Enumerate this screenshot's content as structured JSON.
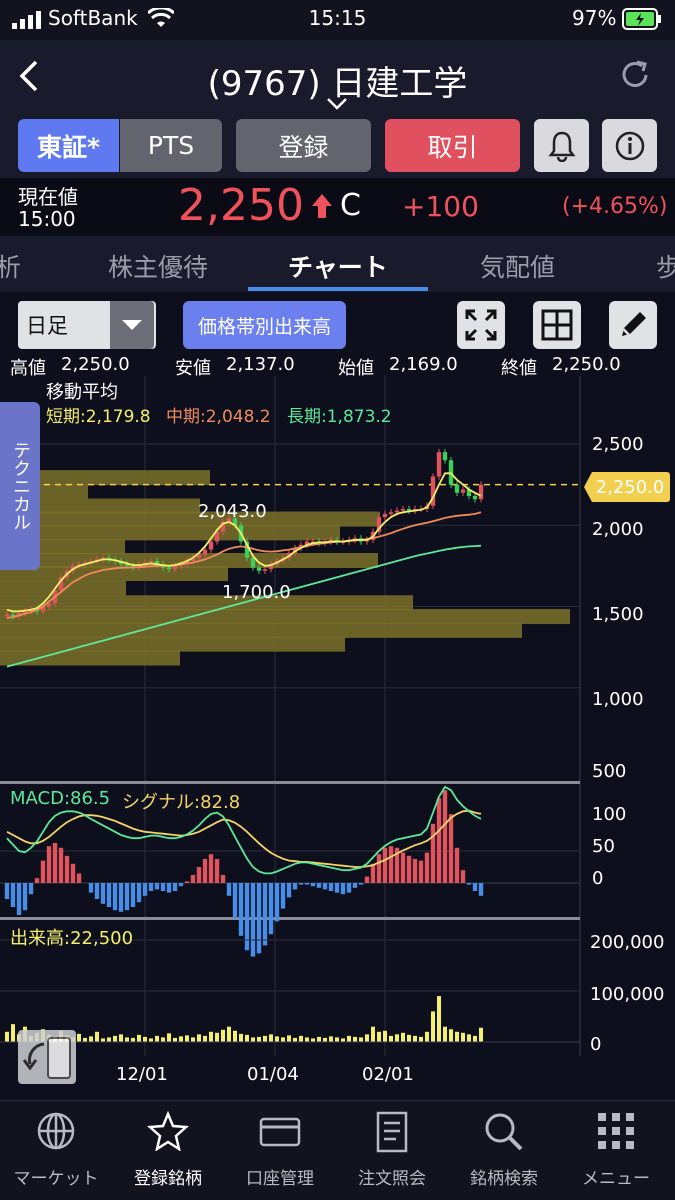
{
  "status": {
    "carrier": "SoftBank",
    "time": "15:15",
    "battery": "97%"
  },
  "header": {
    "title": "(9767) 日建工学"
  },
  "buttons": {
    "market": "東証*",
    "pts": "PTS",
    "register": "登録",
    "trade": "取引"
  },
  "price": {
    "label": "現在値",
    "time": "15:00",
    "value": "2,250",
    "flag": "C",
    "change": "+100",
    "change_pct": "(+4.65%)"
  },
  "tabs": [
    {
      "label": "析"
    },
    {
      "label": "株主優待"
    },
    {
      "label": "チャート"
    },
    {
      "label": "気配値"
    },
    {
      "label": "歩"
    }
  ],
  "chart_controls": {
    "period": "日足",
    "volume_profile": "価格帯別出来高"
  },
  "ohlc": {
    "high_label": "高値",
    "high": "2,250.0",
    "low_label": "安値",
    "low": "2,137.0",
    "open_label": "始値",
    "open": "2,169.0",
    "close_label": "終値",
    "close": "2,250.0"
  },
  "technical_tab": "テクニカル",
  "moving_average": {
    "title": "移動平均",
    "short": "短期:2,179.8",
    "mid": "中期:2,048.2",
    "long": "長期:1,873.2",
    "colors": {
      "short": "#f4f06a",
      "mid": "#f08a5d",
      "long": "#5ee89a"
    }
  },
  "annotations": {
    "peak": "2,043.0",
    "trough": "1,700.0",
    "current": "2,250.0"
  },
  "price_axis": [
    "2,500",
    "2,000",
    "1,500",
    "1,000",
    "500"
  ],
  "macd": {
    "label": "MACD:86.5",
    "signal": "シグナル:82.8",
    "axis": [
      "100",
      "50",
      "0"
    ]
  },
  "volume": {
    "label": "出来高:22,500",
    "axis": [
      "200,000",
      "100,000",
      "0"
    ]
  },
  "x_axis": [
    "12/01",
    "01/04",
    "02/01"
  ],
  "bottom_nav": [
    {
      "label": "マーケット"
    },
    {
      "label": "登録銘柄"
    },
    {
      "label": "口座管理"
    },
    {
      "label": "注文照会"
    },
    {
      "label": "銘柄検索"
    },
    {
      "label": "メニュー"
    }
  ],
  "chart_data": {
    "type": "candlestick",
    "ylim": [
      500,
      2600
    ],
    "closes": [
      1450,
      1440,
      1460,
      1470,
      1480,
      1470,
      1500,
      1520,
      1600,
      1680,
      1720,
      1750,
      1760,
      1770,
      1780,
      1790,
      1800,
      1790,
      1780,
      1760,
      1750,
      1740,
      1760,
      1770,
      1780,
      1760,
      1740,
      1730,
      1750,
      1760,
      1780,
      1800,
      1820,
      1850,
      1900,
      1960,
      2020,
      2043,
      2000,
      1900,
      1800,
      1740,
      1720,
      1730,
      1760,
      1780,
      1800,
      1830,
      1860,
      1880,
      1900,
      1900,
      1890,
      1900,
      1910,
      1900,
      1900,
      1910,
      1920,
      1900,
      1910,
      1960,
      2050,
      2070,
      2080,
      2090,
      2100,
      2090,
      2100,
      2100,
      2120,
      2300,
      2450,
      2400,
      2250,
      2200,
      2220,
      2180,
      2160,
      2250
    ],
    "ma_short": [
      1480,
      1470,
      1470,
      1475,
      1480,
      1490,
      1520,
      1560,
      1610,
      1660,
      1700,
      1730,
      1750,
      1760,
      1770,
      1780,
      1790,
      1790,
      1785,
      1775,
      1765,
      1755,
      1755,
      1760,
      1765,
      1760,
      1755,
      1750,
      1755,
      1765,
      1780,
      1800,
      1830,
      1870,
      1920,
      1970,
      2010,
      2020,
      2000,
      1950,
      1880,
      1810,
      1770,
      1750,
      1755,
      1770,
      1790,
      1810,
      1840,
      1860,
      1880,
      1890,
      1895,
      1895,
      1900,
      1900,
      1900,
      1905,
      1910,
      1910,
      1910,
      1930,
      1980,
      2020,
      2050,
      2070,
      2080,
      2085,
      2090,
      2095,
      2110,
      2170,
      2250,
      2320,
      2320,
      2280,
      2250,
      2220,
      2200,
      2180
    ],
    "ma_mid": [
      1430,
      1435,
      1445,
      1455,
      1465,
      1480,
      1500,
      1530,
      1560,
      1590,
      1620,
      1650,
      1670,
      1690,
      1705,
      1715,
      1725,
      1730,
      1735,
      1738,
      1740,
      1740,
      1742,
      1745,
      1748,
      1750,
      1750,
      1752,
      1755,
      1760,
      1765,
      1770,
      1780,
      1790,
      1805,
      1820,
      1840,
      1855,
      1865,
      1870,
      1865,
      1855,
      1845,
      1840,
      1838,
      1840,
      1845,
      1850,
      1858,
      1865,
      1872,
      1880,
      1886,
      1890,
      1895,
      1898,
      1900,
      1903,
      1906,
      1910,
      1914,
      1920,
      1930,
      1940,
      1952,
      1965,
      1978,
      1990,
      2000,
      2008,
      2015,
      2025,
      2035,
      2045,
      2052,
      2058,
      2062,
      2065,
      2070,
      2080
    ],
    "ma_long": [
      1130,
      1140,
      1150,
      1160,
      1170,
      1180,
      1190,
      1200,
      1210,
      1220,
      1230,
      1240,
      1250,
      1260,
      1270,
      1280,
      1290,
      1300,
      1310,
      1320,
      1330,
      1340,
      1350,
      1360,
      1370,
      1380,
      1390,
      1400,
      1410,
      1420,
      1430,
      1440,
      1450,
      1460,
      1470,
      1480,
      1490,
      1500,
      1510,
      1520,
      1530,
      1540,
      1550,
      1560,
      1570,
      1580,
      1590,
      1600,
      1610,
      1620,
      1630,
      1640,
      1650,
      1660,
      1670,
      1680,
      1690,
      1700,
      1710,
      1720,
      1730,
      1740,
      1750,
      1760,
      1770,
      1780,
      1790,
      1800,
      1810,
      1818,
      1826,
      1834,
      1842,
      1850,
      1856,
      1862,
      1866,
      1870,
      1872,
      1874
    ],
    "macd": [
      70,
      60,
      50,
      48,
      55,
      65,
      80,
      95,
      105,
      110,
      112,
      112,
      110,
      106,
      100,
      95,
      90,
      85,
      80,
      75,
      72,
      70,
      70,
      72,
      74,
      74,
      72,
      70,
      70,
      72,
      76,
      82,
      90,
      100,
      108,
      110,
      104,
      90,
      72,
      55,
      38,
      25,
      18,
      15,
      15,
      18,
      22,
      26,
      30,
      32,
      32,
      30,
      28,
      26,
      24,
      22,
      20,
      20,
      22,
      24,
      30,
      40,
      50,
      58,
      64,
      68,
      70,
      72,
      74,
      76,
      85,
      110,
      135,
      150,
      145,
      130,
      120,
      112,
      105,
      100
    ],
    "signal": [
      80,
      75,
      70,
      65,
      62,
      62,
      66,
      72,
      80,
      88,
      95,
      100,
      104,
      106,
      106,
      105,
      103,
      100,
      97,
      93,
      89,
      85,
      82,
      80,
      79,
      78,
      77,
      76,
      75,
      74,
      75,
      77,
      80,
      85,
      90,
      95,
      99,
      98,
      94,
      88,
      80,
      71,
      62,
      54,
      47,
      42,
      38,
      35,
      34,
      33,
      33,
      32,
      31,
      30,
      29,
      28,
      27,
      26,
      25,
      25,
      26,
      28,
      32,
      36,
      41,
      46,
      51,
      55,
      59,
      62,
      66,
      73,
      82,
      92,
      102,
      108,
      112,
      113,
      110,
      108
    ],
    "volume": [
      20000,
      35000,
      15000,
      30000,
      12000,
      18000,
      25000,
      14000,
      10000,
      22000,
      13000,
      9000,
      16000,
      8000,
      11000,
      20000,
      7000,
      9000,
      12000,
      15000,
      9000,
      8000,
      14000,
      10000,
      7000,
      12000,
      9000,
      17000,
      8000,
      11000,
      13000,
      9000,
      15000,
      12000,
      20000,
      18000,
      24000,
      30000,
      22000,
      16000,
      14000,
      9000,
      10000,
      12000,
      15000,
      11000,
      9000,
      13000,
      8000,
      12000,
      9000,
      7000,
      10000,
      8000,
      11000,
      9000,
      7000,
      12000,
      10000,
      9000,
      15000,
      30000,
      20000,
      22000,
      12000,
      15000,
      18000,
      14000,
      12000,
      10000,
      20000,
      60000,
      90000,
      30000,
      25000,
      20000,
      18000,
      15000,
      12000,
      28000
    ],
    "volume_profile": [
      {
        "price": 2290,
        "len": 210
      },
      {
        "price": 2205,
        "len": 88
      },
      {
        "price": 2115,
        "len": 200
      },
      {
        "price": 2035,
        "len": 380
      },
      {
        "price": 1950,
        "len": 340
      },
      {
        "price": 1865,
        "len": 125
      },
      {
        "price": 1780,
        "len": 378
      },
      {
        "price": 1700,
        "len": 228
      },
      {
        "price": 1610,
        "len": 126
      },
      {
        "price": 1520,
        "len": 413
      },
      {
        "price": 1435,
        "len": 570
      },
      {
        "price": 1350,
        "len": 522
      },
      {
        "price": 1265,
        "len": 345
      },
      {
        "price": 1180,
        "len": 180
      }
    ]
  }
}
